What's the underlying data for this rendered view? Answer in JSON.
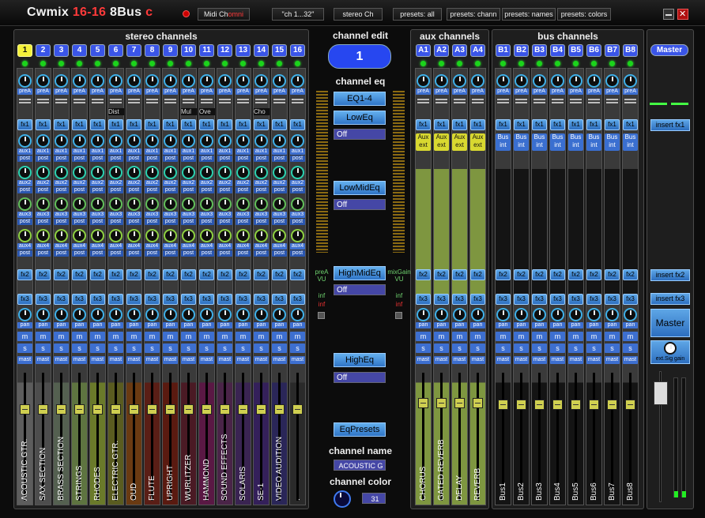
{
  "title": {
    "part1": "Cwmix ",
    "part2": "16-16",
    "part3": " 8Bus ",
    "part4": "c"
  },
  "toolbar": [
    {
      "label": "Midi Ch",
      "suffix": "omni"
    },
    {
      "label": "\"ch 1...32\"",
      "suffix": ""
    },
    {
      "label": "stereo Ch",
      "suffix": ""
    },
    {
      "label": "presets: all",
      "suffix": ""
    },
    {
      "label": "presets: chann",
      "suffix": ""
    },
    {
      "label": "presets: names",
      "suffix": ""
    },
    {
      "label": "presets: colors",
      "suffix": ""
    }
  ],
  "panels": {
    "stereo": "stereo channels",
    "aux": "aux channels",
    "bus": "bus channels"
  },
  "labels": {
    "preA": "preA",
    "fx1": "fx1",
    "fx2": "fx2",
    "fx3": "fx3",
    "aux1": "aux1",
    "aux2": "aux2",
    "aux3": "aux3",
    "aux4": "aux4",
    "post": "post",
    "pan": "pan",
    "m": "m",
    "s": "s",
    "mast": "mast",
    "aux_ext": "Aux ext",
    "bus_int": "Bus int"
  },
  "stereo_channels": [
    {
      "num": "1",
      "name": "ACOUSTIC GTR.",
      "color": "#5d5d5d",
      "dbl": ""
    },
    {
      "num": "2",
      "name": "SAX SECTION",
      "color": "#4d4d4d",
      "dbl": ""
    },
    {
      "num": "3",
      "name": "BRASS SECTION",
      "color": "#546050",
      "dbl": ""
    },
    {
      "num": "4",
      "name": "STRINGS",
      "color": "#5e7440",
      "dbl": ""
    },
    {
      "num": "5",
      "name": "RHODES",
      "color": "#6a7a2a",
      "dbl": ""
    },
    {
      "num": "6",
      "name": "ELECTRIC GTR.",
      "color": "#5a5c20",
      "dbl": "Dist"
    },
    {
      "num": "7",
      "name": "OUD",
      "color": "#6a3a12",
      "dbl": ""
    },
    {
      "num": "8",
      "name": "FLUTE",
      "color": "#5a1e16",
      "dbl": ""
    },
    {
      "num": "9",
      "name": "UPRIGHT",
      "color": "#5a1a10",
      "dbl": ""
    },
    {
      "num": "10",
      "name": "WURLITZER",
      "color": "#4a1a24",
      "dbl": "Mul"
    },
    {
      "num": "11",
      "name": "HAMMOND",
      "color": "#5a1844",
      "dbl": "Ove"
    },
    {
      "num": "12",
      "name": "SOUND EFFECTS",
      "color": "#4a2448",
      "dbl": ""
    },
    {
      "num": "13",
      "name": "SOLARIS",
      "color": "#3a2452",
      "dbl": ""
    },
    {
      "num": "14",
      "name": "SE-1",
      "color": "#34205a",
      "dbl": "Cho"
    },
    {
      "num": "15",
      "name": "VIDEO AUDITION",
      "color": "#2a2658",
      "dbl": ""
    },
    {
      "num": "16",
      "name": ".",
      "color": "#2a2a2a",
      "dbl": ""
    }
  ],
  "aux_channels": [
    {
      "num": "A1",
      "name": "CHORUS",
      "color": "#7e9640"
    },
    {
      "num": "A2",
      "name": "GATED REVERB",
      "color": "#7e9640"
    },
    {
      "num": "A3",
      "name": "DELAY",
      "color": "#7e9640"
    },
    {
      "num": "A4",
      "name": "REVERB",
      "color": "#7e9640"
    }
  ],
  "bus_channels": [
    {
      "num": "B1",
      "name": "Bus1"
    },
    {
      "num": "B2",
      "name": "Bus2"
    },
    {
      "num": "B3",
      "name": "Bus3"
    },
    {
      "num": "B4",
      "name": "Bus4"
    },
    {
      "num": "B5",
      "name": "Bus5"
    },
    {
      "num": "B6",
      "name": "Bus6"
    },
    {
      "num": "B7",
      "name": "Bus7"
    },
    {
      "num": "B8",
      "name": "Bus8"
    }
  ],
  "center": {
    "channel_edit_label": "channel edit",
    "channel_edit_value": "1",
    "channel_eq_label": "channel eq",
    "eq_mode": "EQ1-4",
    "low_eq": "LowEq",
    "low_eq_value": "Off",
    "lowmid_eq": "LowMidEq",
    "lowmid_eq_value": "Off",
    "highmid_eq": "HighMidEq",
    "highmid_eq_value": "Off",
    "high_eq": "HighEq",
    "high_eq_value": "Off",
    "eq_presets": "EqPresets",
    "channel_name_label": "channel name",
    "channel_name_value": "ACOUSTIC G",
    "channel_color_label": "channel color",
    "channel_color_value": "31",
    "prea_vu": "preA",
    "vu": "VU",
    "mixgain": "mixGain",
    "inf1": "inf",
    "inf2": "inf"
  },
  "master": {
    "title": "Master",
    "insert_fx1": "insert fx1",
    "insert_fx2": "insert fx2",
    "insert_fx3": "insert fx3",
    "master_button": "Master",
    "ext_sig_gain": "ext.Sig gain"
  }
}
